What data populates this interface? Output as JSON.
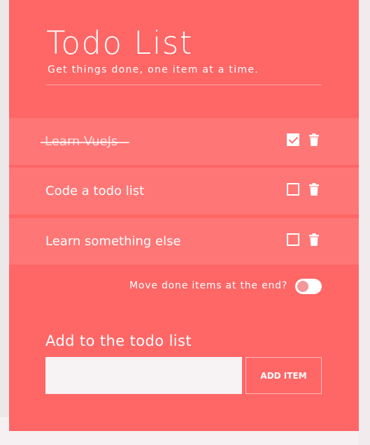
{
  "header": {
    "title": "Todo List",
    "subtitle": "Get things done, one item at a time."
  },
  "items": [
    {
      "label": "Learn VueJs",
      "done": true
    },
    {
      "label": "Code a todo list",
      "done": false
    },
    {
      "label": "Learn something else",
      "done": false
    }
  ],
  "options": {
    "move_done_label": "Move done items at the end?",
    "move_done_enabled": false
  },
  "add_form": {
    "heading": "Add to the todo list",
    "input_value": "",
    "button_label": "ADD ITEM"
  },
  "colors": {
    "card_background": "#ff6666",
    "item_background": "#ff7676",
    "text": "#ffffff"
  },
  "icons": {
    "checkbox": "checkbox-icon",
    "delete": "trash-icon"
  }
}
